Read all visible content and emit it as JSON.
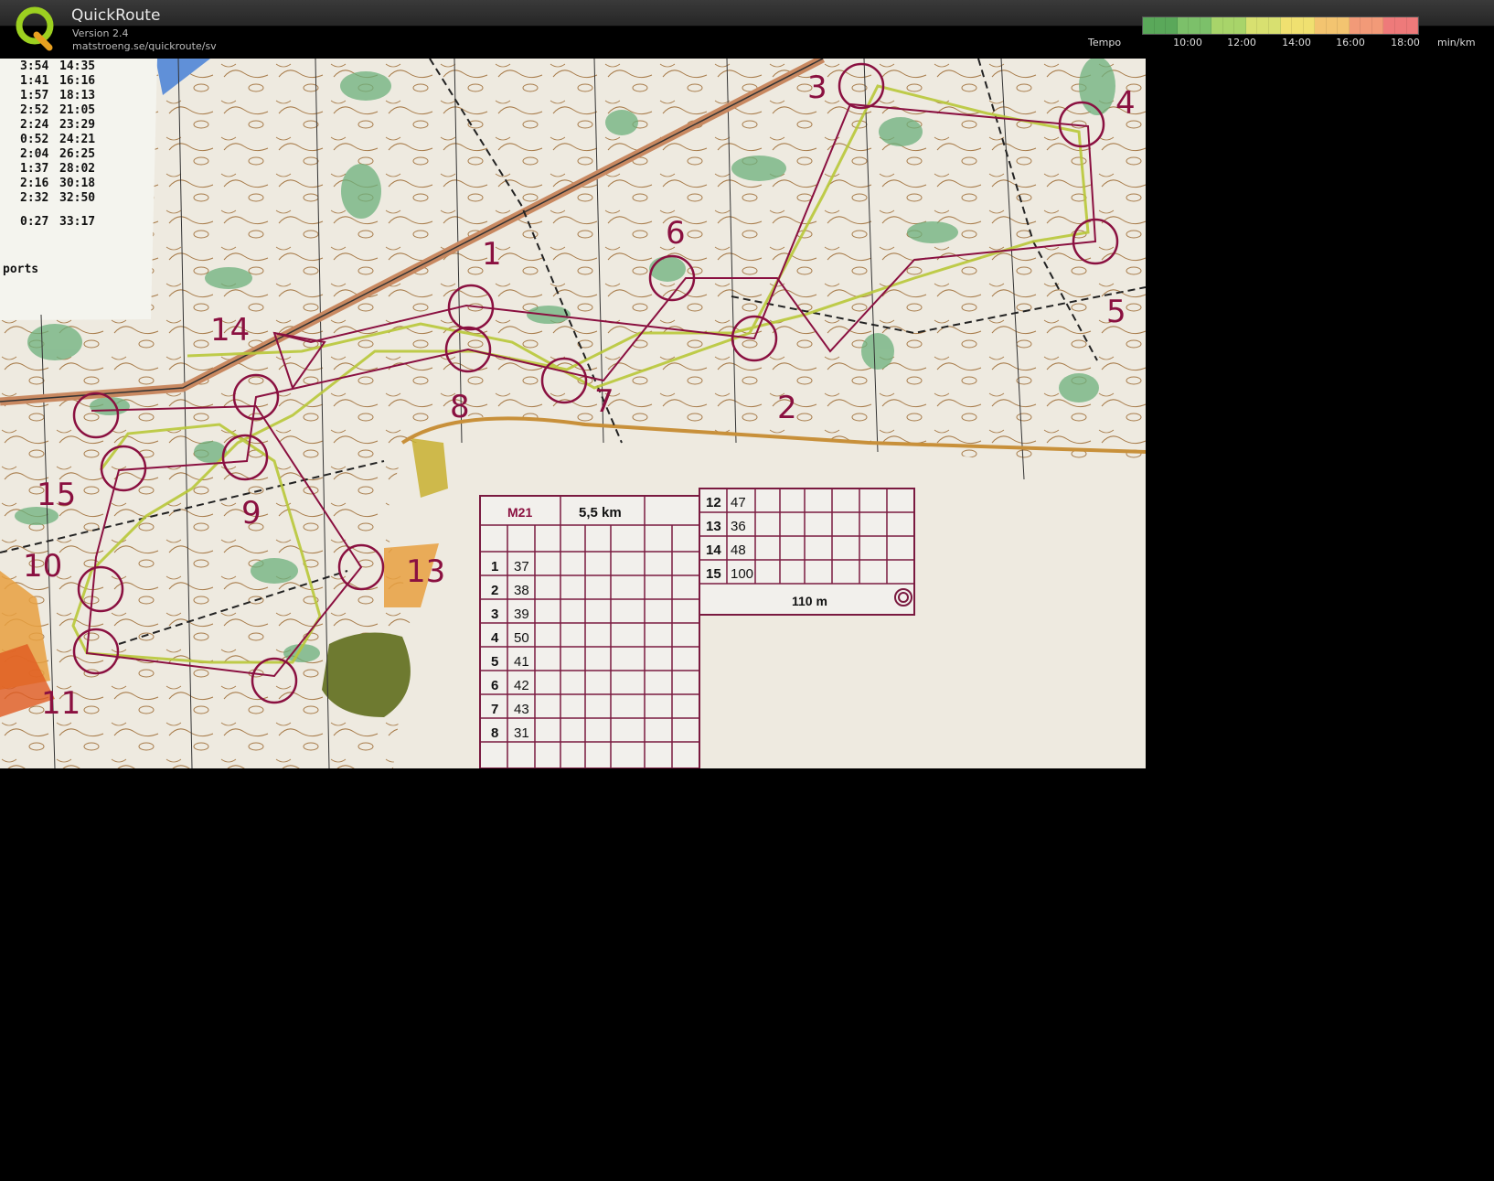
{
  "app": {
    "name": "QuickRoute",
    "version": "Version 2.4",
    "url": "matstroeng.se/quickroute/sv"
  },
  "tempo_legend": {
    "label": "Tempo",
    "ticks": [
      "10:00",
      "12:00",
      "14:00",
      "16:00",
      "18:00"
    ],
    "unit": "min/km",
    "colors": [
      "#5aa85a",
      "#7cc06a",
      "#a8d46a",
      "#d8e070",
      "#f0e070",
      "#f3c470",
      "#f29a78",
      "#ee7a7a"
    ]
  },
  "splits": [
    [
      "3:54",
      "14:35"
    ],
    [
      "1:41",
      "16:16"
    ],
    [
      "1:57",
      "18:13"
    ],
    [
      "2:52",
      "21:05"
    ],
    [
      "2:24",
      "23:29"
    ],
    [
      "0:52",
      "24:21"
    ],
    [
      "2:04",
      "26:25"
    ],
    [
      "1:37",
      "28:02"
    ],
    [
      "2:16",
      "30:18"
    ],
    [
      "2:32",
      "32:50"
    ],
    [
      "0:27",
      "33:17"
    ]
  ],
  "sheet_text": "ports",
  "control_labels": [
    "1",
    "2",
    "3",
    "4",
    "5",
    "6",
    "7",
    "8",
    "9",
    "10",
    "11",
    "13",
    "14",
    "15"
  ],
  "description_sheet": {
    "class": "M21",
    "length": "5,5 km",
    "left_rows": [
      [
        "1",
        "37"
      ],
      [
        "2",
        "38"
      ],
      [
        "3",
        "39"
      ],
      [
        "4",
        "50"
      ],
      [
        "5",
        "41"
      ],
      [
        "6",
        "42"
      ],
      [
        "7",
        "43"
      ],
      [
        "8",
        "31"
      ]
    ],
    "right_rows": [
      [
        "12",
        "47"
      ],
      [
        "13",
        "36"
      ],
      [
        "14",
        "48"
      ],
      [
        "15",
        "100"
      ]
    ],
    "finish_distance": "110 m"
  },
  "colors": {
    "course": "#8a1040",
    "route": "#b8c838",
    "paper": "#eeeae0",
    "vegetation": "#6cb07c",
    "contour": "#a0703a"
  }
}
